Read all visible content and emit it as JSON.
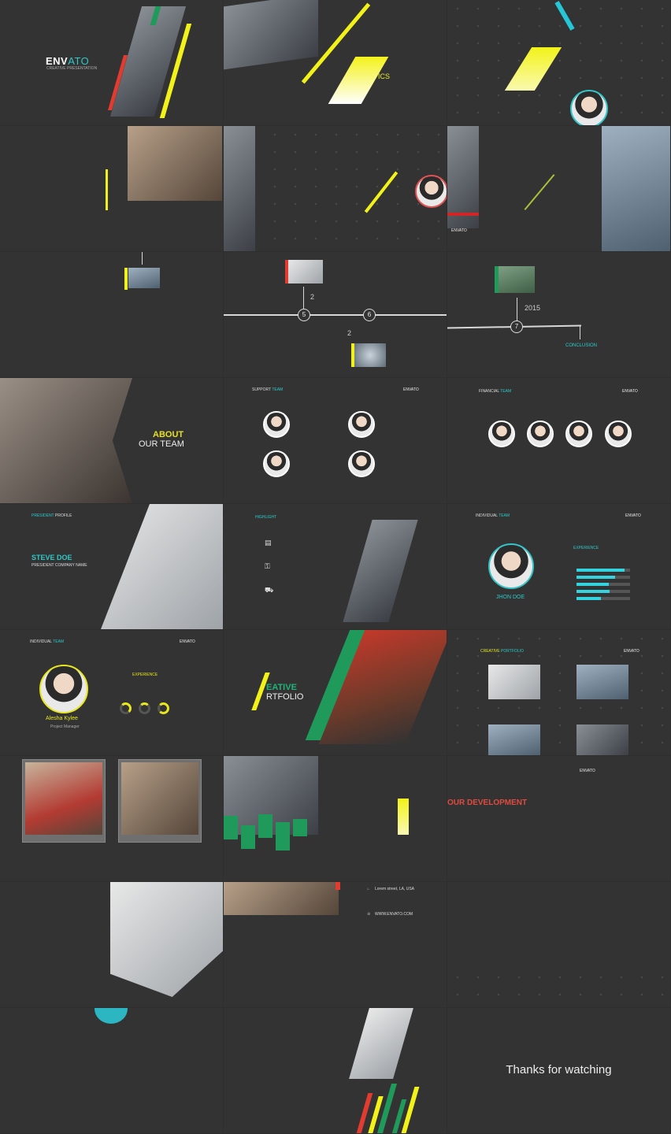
{
  "slides": {
    "s1": {
      "brand_a": "ENV",
      "brand_b": "ATO",
      "subtitle": "CREATIVE PRESENTATION"
    },
    "s2": {
      "label": "ICS"
    },
    "s6": {
      "logo": "ENVATO"
    },
    "s8": {
      "n1": "5",
      "n2": "6",
      "c1": "2",
      "c2": "2"
    },
    "s9": {
      "year": "2015",
      "node": "7",
      "conclusion": "CONCLUSION"
    },
    "s10": {
      "title": "ABOUT",
      "subtitle": "OUR TEAM"
    },
    "s11": {
      "title_a": "SUPPORT",
      "title_b": "TEAM",
      "logo": "ENVATO"
    },
    "s12": {
      "title_a": "FINANCIAL",
      "title_b": "TEAM",
      "logo": "ENVATO"
    },
    "s13": {
      "kicker_a": "PRESIDENT",
      "kicker_b": "PROFILE",
      "name": "STEVE DOE",
      "role": "PRESIDENT COMPANY NAME"
    },
    "s14": {
      "title": "HIGHLIGHT"
    },
    "s15": {
      "title_a": "INDIVIDUAL",
      "title_b": "TEAM",
      "logo": "ENVATO",
      "name": "JHON DOE",
      "section": "EXPERIENCE",
      "bars": [
        0.9,
        0.72,
        0.6,
        0.62,
        0.45
      ]
    },
    "s16": {
      "title_a": "INDIVIDUAL",
      "title_b": "TEAM",
      "logo": "ENVATO",
      "name": "Alesha Kylee",
      "role": "Project Manager",
      "section": "EXPERIENCE"
    },
    "s17": {
      "title_a": "EATIVE",
      "title_b": "RTFOLIO"
    },
    "s18": {
      "title_a": "CREATIVE",
      "title_b": "PORTFOLIO",
      "logo": "ENVATO"
    },
    "s21": {
      "logo": "ENVATO",
      "title": "OUR DEVELOPMENT"
    },
    "s23": {
      "address": "Lorem street, LA, USA",
      "site": "WWW.ENVATO.COM"
    },
    "s27": {
      "thanks": "Thanks for watching"
    }
  }
}
